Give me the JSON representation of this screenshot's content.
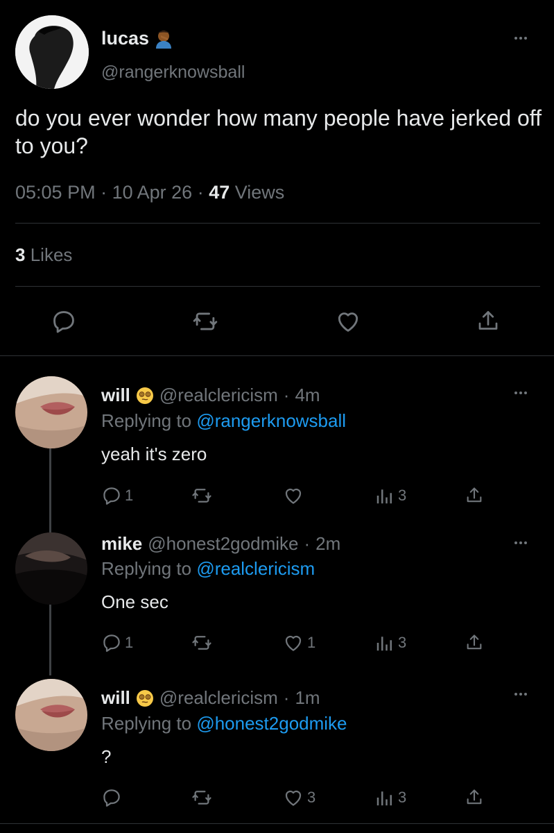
{
  "main_tweet": {
    "display_name": "lucas",
    "handle": "@rangerknowsball",
    "text": "do you ever wonder how many people have jerked off to you?",
    "time": "05:05 PM",
    "date": "10 Apr 26",
    "views_count": "47",
    "views_label": "Views",
    "likes_count": "3",
    "likes_label": "Likes",
    "emoji_icon": "person-facepalming-emoji"
  },
  "replies": [
    {
      "display_name": "will",
      "emoji_icon": "dizzy-face-emoji",
      "handle": "@realclericism",
      "age": "4m",
      "replying_prefix": "Replying to",
      "replying_to": "@rangerknowsball",
      "text": "yeah it's zero",
      "replies_count": "1",
      "retweets_count": "",
      "likes_count": "",
      "views_count": "3"
    },
    {
      "display_name": "mike",
      "handle": "@honest2godmike",
      "age": "2m",
      "replying_prefix": "Replying to",
      "replying_to": "@realclericism",
      "text": "One sec",
      "replies_count": "1",
      "retweets_count": "",
      "likes_count": "1",
      "views_count": "3"
    },
    {
      "display_name": "will",
      "emoji_icon": "dizzy-face-emoji",
      "handle": "@realclericism",
      "age": "1m",
      "replying_prefix": "Replying to",
      "replying_to": "@honest2godmike",
      "text": "?",
      "replies_count": "",
      "retweets_count": "",
      "likes_count": "3",
      "views_count": "3"
    }
  ],
  "colors": {
    "background": "#000000",
    "text": "#e7e9ea",
    "secondary": "#71767b",
    "link": "#1d9bf0",
    "divider": "#2f3336"
  }
}
